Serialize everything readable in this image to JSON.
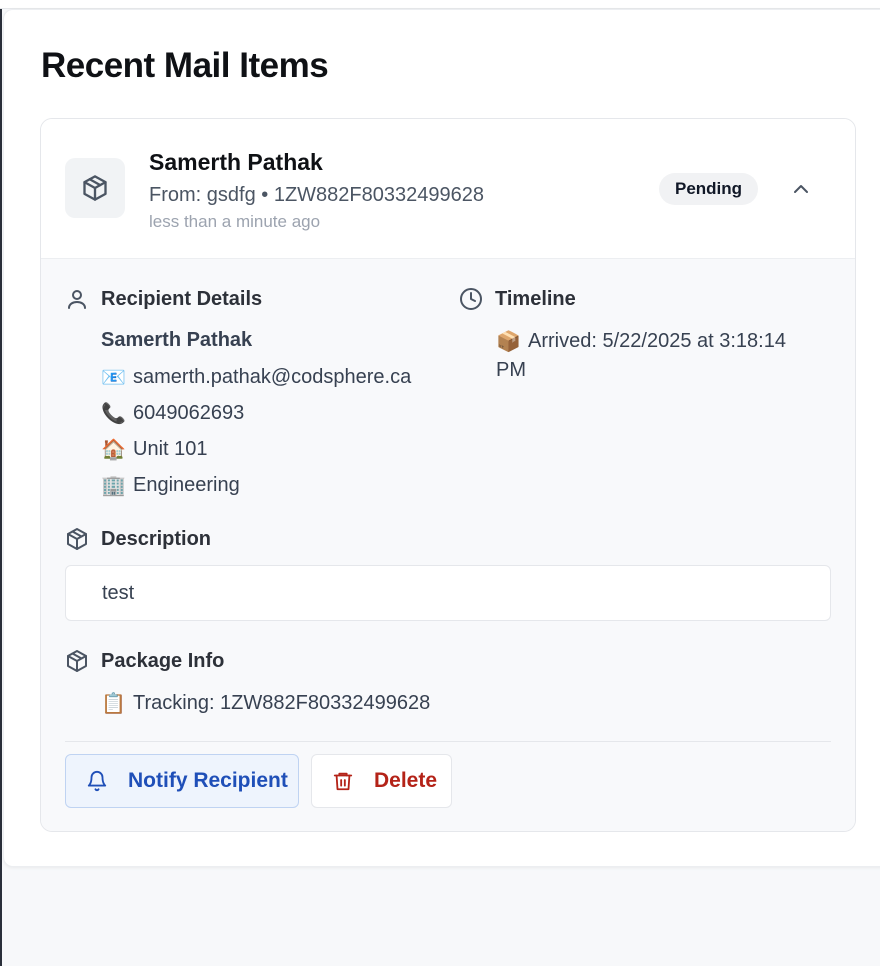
{
  "section": {
    "title": "Recent Mail Items"
  },
  "item": {
    "recipient_name": "Samerth Pathak",
    "from_line": "From: gsdfg • 1ZW882F80332499628",
    "relative_time": "less than a minute ago",
    "status": "Pending"
  },
  "details": {
    "recipient_heading": "Recipient Details",
    "name": "Samerth Pathak",
    "email_emoji": "📧",
    "email": "samerth.pathak@codsphere.ca",
    "phone_emoji": "📞",
    "phone": "6049062693",
    "unit_emoji": "🏠",
    "unit": "Unit 101",
    "dept_emoji": "🏢",
    "department": "Engineering",
    "timeline_heading": "Timeline",
    "arrived_emoji": "📦",
    "arrived_line1": "Arrived: 5/22/2025 at 3:18:14",
    "arrived_line2": "PM",
    "description_heading": "Description",
    "description": "test",
    "package_heading": "Package Info",
    "tracking_emoji": "📋",
    "tracking": "Tracking: 1ZW882F80332499628"
  },
  "actions": {
    "notify_label": "Notify Recipient",
    "delete_label": "Delete"
  },
  "colors": {
    "notify_text": "#1f4fb8",
    "delete_text": "#b42318",
    "badge_bg": "#f1f2f4"
  }
}
